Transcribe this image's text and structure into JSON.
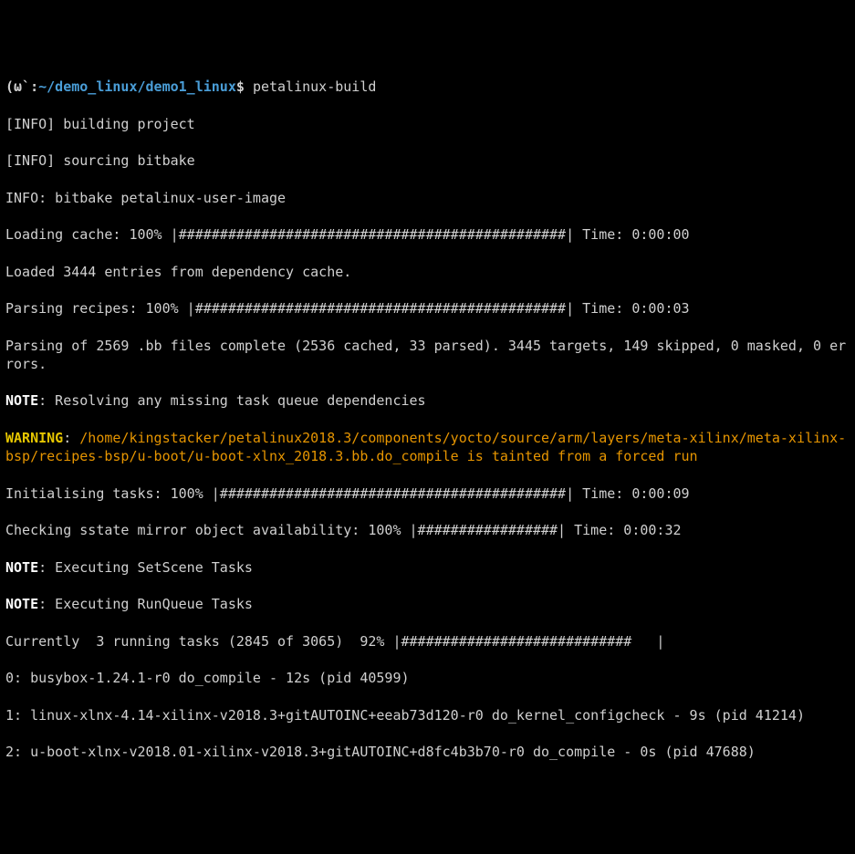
{
  "prompt": {
    "desktop": "(ω`",
    "sep": ":",
    "path": "~/demo_linux/demo1_linux",
    "suffix": "$ ",
    "command": "petalinux-build"
  },
  "lines": {
    "l1": "[INFO] building project",
    "l2": "[INFO] sourcing bitbake",
    "l3": "INFO: bitbake petalinux-user-image",
    "l4": "Loading cache: 100% |###############################################| Time: 0:00:00",
    "l5": "Loaded 3444 entries from dependency cache.",
    "l6": "Parsing recipes: 100% |#############################################| Time: 0:00:03",
    "l7": "Parsing of 2569 .bb files complete (2536 cached, 33 parsed). 3445 targets, 149 skipped, 0 masked, 0 errors.",
    "l8_note": "NOTE",
    "l8_rest": ": Resolving any missing task queue dependencies",
    "l9_warn": "WARNING",
    "l9_sep": ": ",
    "l9_path": "/home/kingstacker/petalinux2018.3/components/yocto/source/arm/layers/meta-xilinx/meta-xilinx-bsp/recipes-bsp/u-boot/u-boot-xlnx_2018.3.bb.do_compile is tainted from a forced run",
    "l10": "Initialising tasks: 100% |##########################################| Time: 0:00:09",
    "l11": "Checking sstate mirror object availability: 100% |#################| Time: 0:00:32",
    "l12_note": "NOTE",
    "l12_rest": ": Executing SetScene Tasks",
    "l13_note": "NOTE",
    "l13_rest": ": Executing RunQueue Tasks",
    "l14": "Currently  3 running tasks (2845 of 3065)  92% |############################   |",
    "l15": "0: busybox-1.24.1-r0 do_compile - 12s (pid 40599)",
    "l16": "1: linux-xlnx-4.14-xilinx-v2018.3+gitAUTOINC+eeab73d120-r0 do_kernel_configcheck - 9s (pid 41214)",
    "l17": "2: u-boot-xlnx-v2018.01-xilinx-v2018.3+gitAUTOINC+d8fc4b3b70-r0 do_compile - 0s (pid 47688)"
  }
}
